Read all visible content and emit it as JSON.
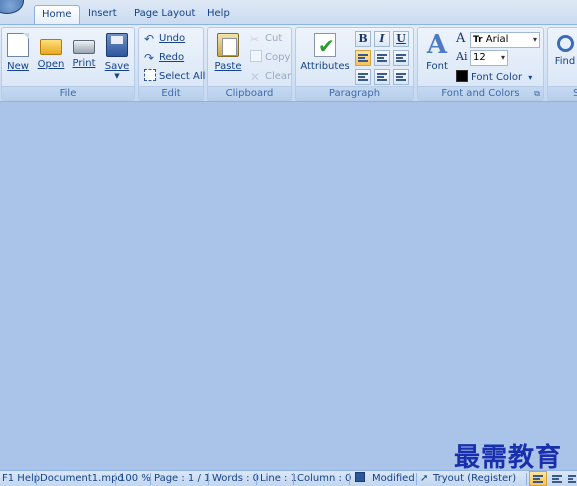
{
  "tabs": [
    "Home",
    "Insert",
    "Page Layout",
    "Help"
  ],
  "active_tab": "Home",
  "groups": {
    "file": {
      "caption": "File",
      "new_label": "New",
      "open_label": "Open",
      "print_label": "Print",
      "save_label": "Save"
    },
    "edit": {
      "caption": "Edit",
      "undo_label": "Undo",
      "redo_label": "Redo",
      "select_all_label": "Select All"
    },
    "clipboard": {
      "caption": "Clipboard",
      "paste_label": "Paste",
      "cut_label": "Cut",
      "copy_label": "Copy",
      "clear_label": "Clear"
    },
    "attributes_label": "Attributes",
    "paragraph": {
      "caption": "Paragraph",
      "bold": "B",
      "italic": "I",
      "underline": "U"
    },
    "font": {
      "caption": "Font and Colors",
      "font_label": "Font",
      "font_name": "Arial",
      "font_size": "12",
      "font_color_label": "Font Color"
    },
    "find_label": "Find",
    "next_caption_stub": "S"
  },
  "status": {
    "help": "F1 Help",
    "document": "Document1.mpd",
    "zoom": "100 %",
    "page": "Page : 1 / 1",
    "words": "Words : 0",
    "line": "Line : 1",
    "column": "Column : 0",
    "modified": "Modified",
    "tryout": "Tryout (Register)"
  },
  "watermark": "最需教育",
  "colors": {
    "ribbon_text": "#15428b",
    "doc_background": "#a9c4e8",
    "highlight": "#f7c35c"
  }
}
